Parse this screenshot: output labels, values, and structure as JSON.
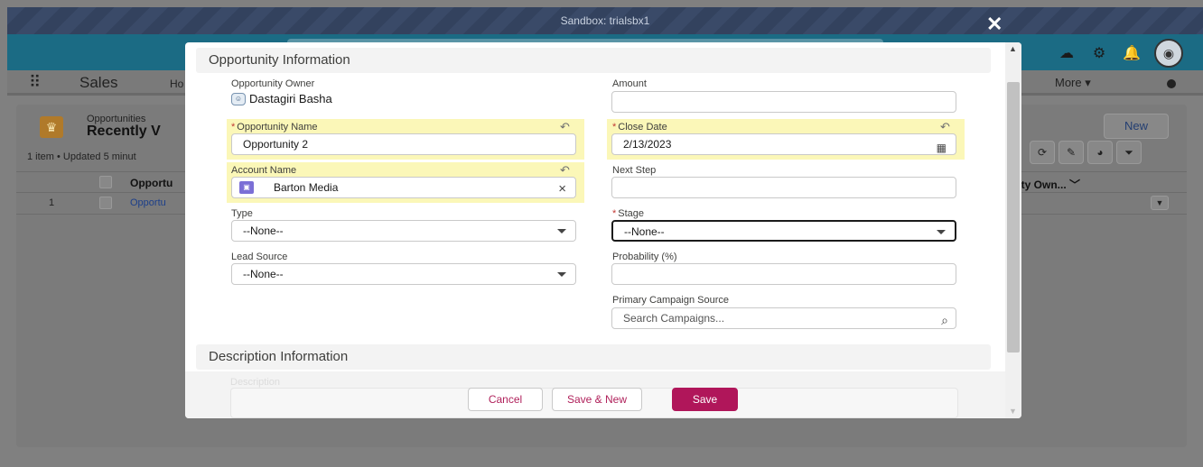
{
  "window": {
    "sandbox_label": "Sandbox: trialsbx1",
    "close_glyph": "✕"
  },
  "nav": {
    "app_name": "Sales",
    "home_tab": "Ho",
    "more": "More ▾"
  },
  "list_view": {
    "object_label": "Opportunities",
    "title": "Recently V",
    "meta": "1 item • Updated 5 minut",
    "new_button": "New",
    "col_opportunity": "Opportu",
    "col_owner": "nity Own... ﹀",
    "row_number": "1",
    "row_link": "Opportu"
  },
  "modal": {
    "section_opportunity": "Opportunity Information",
    "section_description": "Description Information",
    "owner": {
      "label": "Opportunity Owner",
      "value": "Dastagiri Basha"
    },
    "amount": {
      "label": "Amount",
      "value": ""
    },
    "opportunity_name": {
      "required": "*",
      "label": "Opportunity Name",
      "value": "Opportunity 2"
    },
    "close_date": {
      "required": "*",
      "label": "Close Date",
      "value": "2/13/2023"
    },
    "account_name": {
      "label": "Account Name",
      "value": "Barton Media"
    },
    "next_step": {
      "label": "Next Step",
      "value": ""
    },
    "type": {
      "label": "Type",
      "value": "--None--"
    },
    "stage": {
      "required": "*",
      "label": "Stage",
      "value": "--None--"
    },
    "lead_source": {
      "label": "Lead Source",
      "value": "--None--"
    },
    "probability": {
      "label": "Probability (%)",
      "value": ""
    },
    "campaign": {
      "label": "Primary Campaign Source",
      "placeholder": "Search Campaigns..."
    },
    "description_label": "Description"
  },
  "footer": {
    "cancel": "Cancel",
    "save_new": "Save & New",
    "save": "Save"
  },
  "colors": {
    "brand": "#b0165a",
    "required": "#c23934",
    "highlight": "#fbf7b8"
  }
}
